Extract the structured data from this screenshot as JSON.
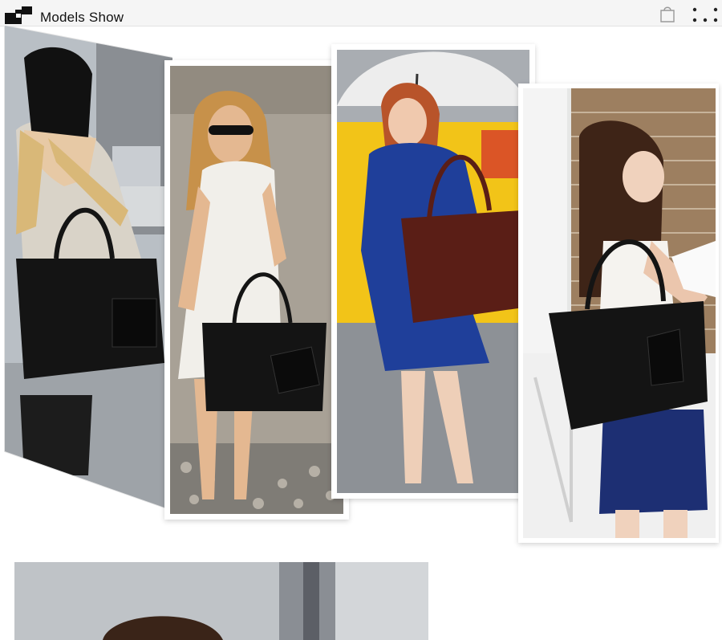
{
  "header": {
    "title": "Models Show",
    "icons": [
      "logo-icon",
      "shopping-bag-icon",
      "more-dots-icon"
    ]
  },
  "gallery": {
    "photos": [
      {
        "name": "model-photo-black-beanie"
      },
      {
        "name": "model-photo-white-dress"
      },
      {
        "name": "model-photo-umbrella-blue-coat"
      },
      {
        "name": "model-photo-brick-wall"
      }
    ],
    "second_section": {
      "name": "model-photo-close-up"
    }
  },
  "colors": {
    "bag_black": "#141414",
    "bag_brown": "#5a1e16",
    "coat_blue": "#1f3f9a",
    "taxi_yellow": "#f2c418"
  }
}
